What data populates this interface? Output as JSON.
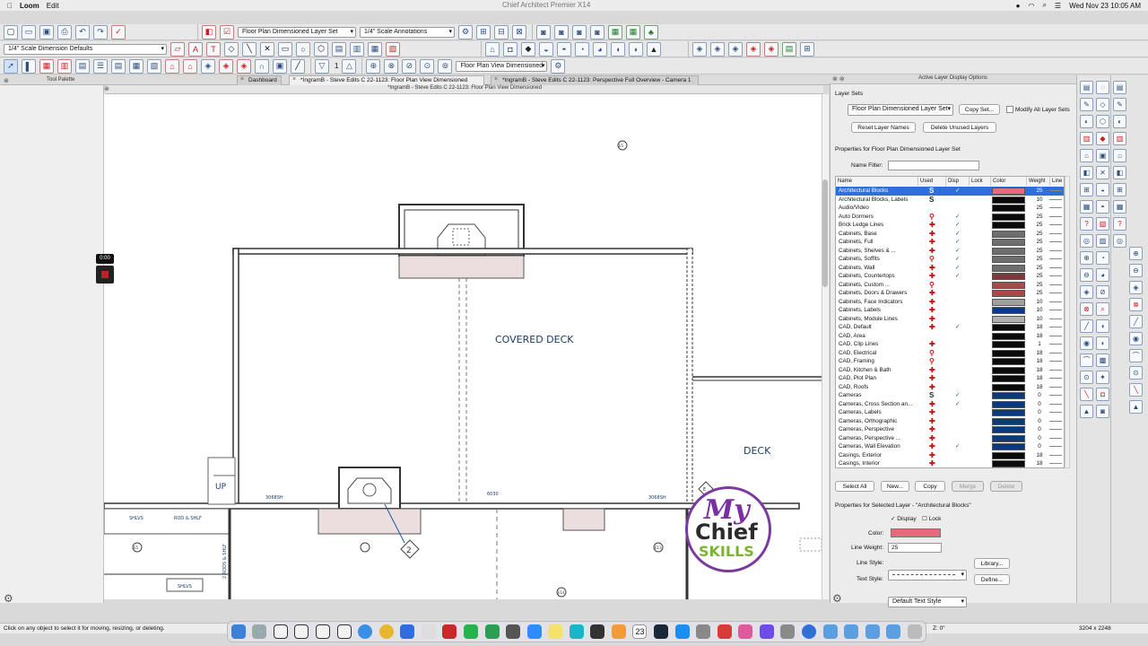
{
  "menubar": {
    "app": "Loom",
    "edit": "Edit",
    "title": "Chief Architect Premier X14",
    "datetime": "Wed Nov 23 10:05 AM"
  },
  "toolbar": {
    "layer_set": "Floor Plan Dimensioned Layer Set",
    "annotation_set": "1/4\" Scale Annotations",
    "dimension_defaults": "1/4\" Scale Dimension Defaults",
    "view": "Floor Plan View Dimensioned",
    "view_number": "1"
  },
  "tabs": {
    "tool_palette": "Tool Palette",
    "dashboard": "Dashboard",
    "tab1": "*IngramB - Steve Edits C 22-1123: Floor Plan View Dimensioned",
    "tab2": "*IngramB - Steve Edits C 22-1123: Perspective Full Overview - Camera 1"
  },
  "doc_title": "*IngramB - Steve Edits C 22-1123: Floor Plan View Dimensioned",
  "loom": {
    "timer": "0:00"
  },
  "plan": {
    "covered_deck": "COVERED DECK",
    "deck": "DECK",
    "up": "UP",
    "dim1": "3068SH",
    "dim2": "6030",
    "dim3": "3068SH",
    "shlvs": "SHLVS",
    "rod_shlf": "ROD & SHLF",
    "shlvs2": "SHLVS",
    "rods": "2 RODS & SHLF",
    "tag": "2",
    "m1": "E5",
    "m2": "E13",
    "m3": "E14",
    "m4": "E5",
    "m5": "E"
  },
  "logo": {
    "line1": "My",
    "line2": "Chief",
    "line3": "SKILLS"
  },
  "panel": {
    "title": "Active Layer Display Options",
    "layer_sets_label": "Layer Sets",
    "layer_set_value": "Floor Plan Dimensioned Layer Set",
    "copy_set": "Copy Set...",
    "modify_all": "Modify All Layer Sets",
    "reset_names": "Reset Layer Names",
    "delete_unused": "Delete Unused Layers",
    "properties_for": "Properties for Floor Plan Dimensioned Layer Set",
    "name_filter": "Name Filter:",
    "columns": [
      "Name",
      "Used",
      "Disp",
      "Lock",
      "Color",
      "Weight",
      "Line"
    ],
    "rows": [
      {
        "name": "Architectural Blocks",
        "used": "S",
        "disp": "✓",
        "color": "#e8697a",
        "weight": "25"
      },
      {
        "name": "Architectural Blocks, Labels",
        "used": "S",
        "disp": "",
        "color": "#0a0a0a",
        "weight": "10"
      },
      {
        "name": "Audio/Video",
        "used": "",
        "disp": "",
        "color": "#0a0a0a",
        "weight": "25"
      },
      {
        "name": "Auto Dormers",
        "used": "⚲",
        "disp": "✓",
        "color": "#0a0a0a",
        "weight": "25"
      },
      {
        "name": "Brick Ledge Lines",
        "used": "✚",
        "disp": "✓",
        "color": "#0a0a0a",
        "weight": "25"
      },
      {
        "name": "Cabinets, Base",
        "used": "✚",
        "disp": "✓",
        "color": "#6e6e6e",
        "weight": "25"
      },
      {
        "name": "Cabinets,  Full",
        "used": "✚",
        "disp": "✓",
        "color": "#6e6e6e",
        "weight": "25"
      },
      {
        "name": "Cabinets,  Shelves & ...",
        "used": "✚",
        "disp": "✓",
        "color": "#6e6e6e",
        "weight": "25"
      },
      {
        "name": "Cabinets,  Soffits",
        "used": "⚲",
        "disp": "✓",
        "color": "#6e6e6e",
        "weight": "25"
      },
      {
        "name": "Cabinets,  Wall",
        "used": "✚",
        "disp": "✓",
        "color": "#6e6e6e",
        "weight": "25"
      },
      {
        "name": "Cabinets, Countertops",
        "used": "✚",
        "disp": "✓",
        "color": "#7d3a3a",
        "weight": "25"
      },
      {
        "name": "Cabinets, Custom ...",
        "used": "⚲",
        "disp": "",
        "color": "#a84a4a",
        "weight": "25"
      },
      {
        "name": "Cabinets, Doors & Drawers",
        "used": "✚",
        "disp": "",
        "color": "#a84a4a",
        "weight": "25"
      },
      {
        "name": "Cabinets, Face Indicators",
        "used": "✚",
        "disp": "",
        "color": "#a0a0a0",
        "weight": "10"
      },
      {
        "name": "Cabinets, Labels",
        "used": "✚",
        "disp": "",
        "color": "#0a3a8a",
        "weight": "10"
      },
      {
        "name": "Cabinets, Module Lines",
        "used": "✚",
        "disp": "",
        "color": "#b0b0b0",
        "weight": "10"
      },
      {
        "name": "CAD,  Default",
        "used": "✚",
        "disp": "✓",
        "color": "#0a0a0a",
        "weight": "18"
      },
      {
        "name": "CAD, Area",
        "used": "",
        "disp": "",
        "color": "#0a0a0a",
        "weight": "18"
      },
      {
        "name": "CAD, Clip Lines",
        "used": "✚",
        "disp": "",
        "color": "#0a0a0a",
        "weight": "1"
      },
      {
        "name": "CAD, Electrical",
        "used": "⚲",
        "disp": "",
        "color": "#0a0a0a",
        "weight": "18"
      },
      {
        "name": "CAD, Framing",
        "used": "⚲",
        "disp": "",
        "color": "#0a0a0a",
        "weight": "18"
      },
      {
        "name": "CAD, Kitchen & Bath",
        "used": "✚",
        "disp": "",
        "color": "#0a0a0a",
        "weight": "18"
      },
      {
        "name": "CAD, Plot Plan",
        "used": "✚",
        "disp": "",
        "color": "#0a0a0a",
        "weight": "18"
      },
      {
        "name": "CAD, Roofs",
        "used": "✚",
        "disp": "",
        "color": "#0a0a0a",
        "weight": "18"
      },
      {
        "name": "Cameras",
        "used": "S",
        "disp": "✓",
        "color": "#0a3a7a",
        "weight": "0"
      },
      {
        "name": "Cameras, Cross Section an...",
        "used": "✚",
        "disp": "✓",
        "color": "#0a3a7a",
        "weight": "0"
      },
      {
        "name": "Cameras, Labels",
        "used": "✚",
        "disp": "",
        "color": "#0a3a7a",
        "weight": "0"
      },
      {
        "name": "Cameras, Orthographic",
        "used": "✚",
        "disp": "",
        "color": "#0a3a7a",
        "weight": "0"
      },
      {
        "name": "Cameras, Perspective",
        "used": "✚",
        "disp": "",
        "color": "#0a3a7a",
        "weight": "0"
      },
      {
        "name": "Cameras, Perspective ...",
        "used": "✚",
        "disp": "",
        "color": "#0a3a7a",
        "weight": "0"
      },
      {
        "name": "Cameras, Wall Elevation",
        "used": "✚",
        "disp": "✓",
        "color": "#0a3a7a",
        "weight": "0"
      },
      {
        "name": "Casings, Exterior",
        "used": "✚",
        "disp": "",
        "color": "#0a0a0a",
        "weight": "18"
      },
      {
        "name": "Casings, Interior",
        "used": "✚",
        "disp": "",
        "color": "#0a0a0a",
        "weight": "18"
      }
    ],
    "select_all": "Select All",
    "new": "New...",
    "copy": "Copy",
    "merge": "Merge",
    "delete": "Delete",
    "selected_props": "Properties for Selected Layer - \"Architectural Blocks\"",
    "display": "Display",
    "lock": "Lock",
    "color_label": "Color:",
    "color_value": "#e8697a",
    "line_weight_label": "Line Weight:",
    "line_weight_value": "25",
    "line_style_label": "Line Style:",
    "library": "Library...",
    "text_style_label": "Text Style:",
    "text_style_value": "Default Text Style",
    "define": "Define..."
  },
  "status": {
    "message": "Click on any object to select it for moving, resizing, or deleting.",
    "z": "Z: 0\"",
    "size": "3204 x 2248"
  },
  "dock": {
    "date": "23"
  }
}
